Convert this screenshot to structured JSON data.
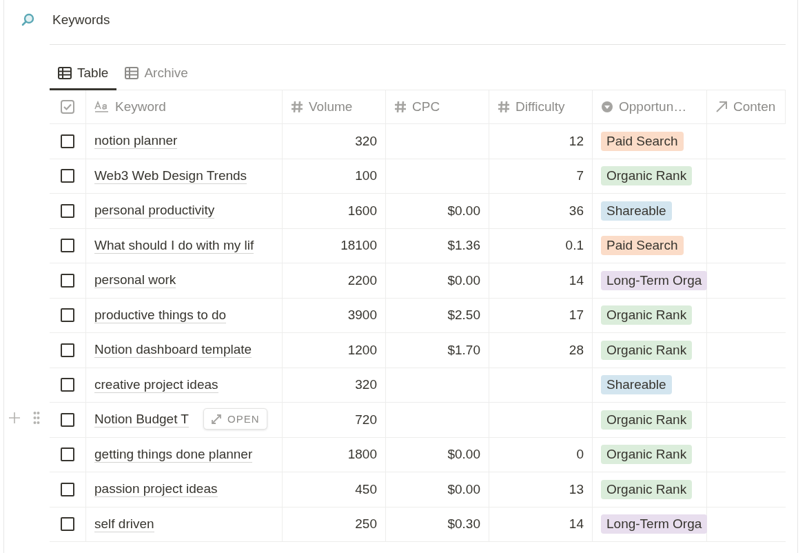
{
  "title": "Keywords",
  "tabs": [
    {
      "label": "Table",
      "selected": true
    },
    {
      "label": "Archive",
      "selected": false
    }
  ],
  "columns": [
    {
      "kind": "title",
      "label": "Keyword"
    },
    {
      "kind": "number",
      "label": "Volume"
    },
    {
      "kind": "number",
      "label": "CPC"
    },
    {
      "kind": "number",
      "label": "Difficulty"
    },
    {
      "kind": "select",
      "label": "Opportun…"
    },
    {
      "kind": "relation",
      "label": "Conten"
    }
  ],
  "rows": [
    {
      "checked": false,
      "hovered": false,
      "keyword": "notion planner",
      "volume": "320",
      "cpc": "",
      "difficulty": "12",
      "opportunity": {
        "label": "Paid Search",
        "color": "#fbdcc8"
      }
    },
    {
      "checked": false,
      "hovered": false,
      "keyword": "Web3 Web Design Trends",
      "volume": "100",
      "cpc": "",
      "difficulty": "7",
      "opportunity": {
        "label": "Organic Rank",
        "color": "#dbeddb"
      }
    },
    {
      "checked": false,
      "hovered": false,
      "keyword": "personal productivity",
      "volume": "1600",
      "cpc": "$0.00",
      "difficulty": "36",
      "opportunity": {
        "label": "Shareable",
        "color": "#d3e5ef"
      }
    },
    {
      "checked": false,
      "hovered": false,
      "keyword": "What should I do with my lif",
      "volume": "18100",
      "cpc": "$1.36",
      "difficulty": "0.1",
      "opportunity": {
        "label": "Paid Search",
        "color": "#fbdcc8"
      }
    },
    {
      "checked": false,
      "hovered": false,
      "keyword": "personal work",
      "volume": "2200",
      "cpc": "$0.00",
      "difficulty": "14",
      "opportunity": {
        "label": "Long-Term Orga",
        "color": "#e8deee"
      }
    },
    {
      "checked": false,
      "hovered": false,
      "keyword": "productive things to do",
      "volume": "3900",
      "cpc": "$2.50",
      "difficulty": "17",
      "opportunity": {
        "label": "Organic Rank",
        "color": "#dbeddb"
      }
    },
    {
      "checked": false,
      "hovered": false,
      "keyword": "Notion dashboard template",
      "volume": "1200",
      "cpc": "$1.70",
      "difficulty": "28",
      "opportunity": {
        "label": "Organic Rank",
        "color": "#dbeddb"
      }
    },
    {
      "checked": false,
      "hovered": false,
      "keyword": "creative project ideas",
      "volume": "320",
      "cpc": "",
      "difficulty": "",
      "opportunity": {
        "label": "Shareable",
        "color": "#d3e5ef"
      }
    },
    {
      "checked": false,
      "hovered": true,
      "keyword": "Notion Budget T",
      "volume": "720",
      "cpc": "",
      "difficulty": "",
      "opportunity": {
        "label": "Organic Rank",
        "color": "#dbeddb"
      }
    },
    {
      "checked": false,
      "hovered": false,
      "keyword": "getting things done planner",
      "volume": "1800",
      "cpc": "$0.00",
      "difficulty": "0",
      "opportunity": {
        "label": "Organic Rank",
        "color": "#dbeddb"
      }
    },
    {
      "checked": false,
      "hovered": false,
      "keyword": "passion project ideas",
      "volume": "450",
      "cpc": "$0.00",
      "difficulty": "13",
      "opportunity": {
        "label": "Organic Rank",
        "color": "#dbeddb"
      }
    },
    {
      "checked": false,
      "hovered": false,
      "keyword": "self driven",
      "volume": "250",
      "cpc": "$0.30",
      "difficulty": "14",
      "opportunity": {
        "label": "Long-Term Orga",
        "color": "#e8deee"
      }
    }
  ],
  "open_button": "OPEN"
}
